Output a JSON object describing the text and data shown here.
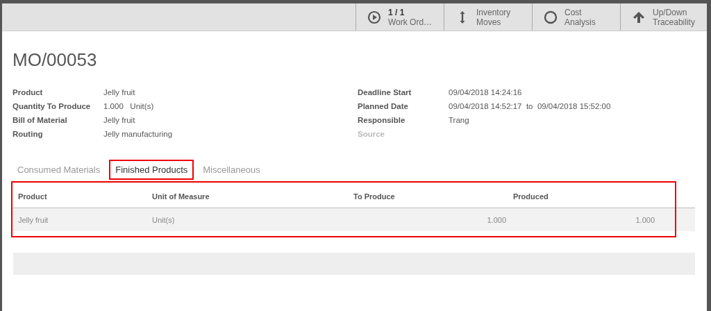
{
  "toolbar": [
    {
      "kind": "play",
      "count": "1 / 1",
      "label": "Work Ord…"
    },
    {
      "kind": "updown",
      "label": "Inventory Moves"
    },
    {
      "kind": "circle",
      "label": "Cost Analysis"
    },
    {
      "kind": "uparrow",
      "label": "Up/Down Traceability"
    }
  ],
  "title": "MO/00053",
  "left_fields": [
    {
      "label": "Product",
      "value": "Jelly fruit"
    },
    {
      "label": "Quantity To Produce",
      "value": "1.000   Unit(s)"
    },
    {
      "label": "Bill of Material",
      "value": "Jelly fruit"
    },
    {
      "label": "Routing",
      "value": "Jelly manufacturing"
    }
  ],
  "right_fields": [
    {
      "label": "Deadline Start",
      "value": "09/04/2018 14:24:16",
      "disabled": false
    },
    {
      "label": "Planned Date",
      "value": "09/04/2018 14:52:17  to  09/04/2018 15:52:00",
      "disabled": false
    },
    {
      "label": "Responsible",
      "value": "Trang",
      "disabled": false
    },
    {
      "label": "Source",
      "disabled": true
    }
  ],
  "tabs": [
    {
      "label": "Consumed Materials",
      "selected": false
    },
    {
      "label": "Finished Products",
      "selected": true
    },
    {
      "label": "Miscellaneous",
      "selected": false
    }
  ],
  "table": {
    "columns": [
      "Product",
      "Unit of Measure",
      "To Produce",
      "Produced"
    ],
    "rows": [
      [
        "Jelly fruit",
        "Unit(s)",
        "1.000",
        "1.000"
      ]
    ]
  }
}
